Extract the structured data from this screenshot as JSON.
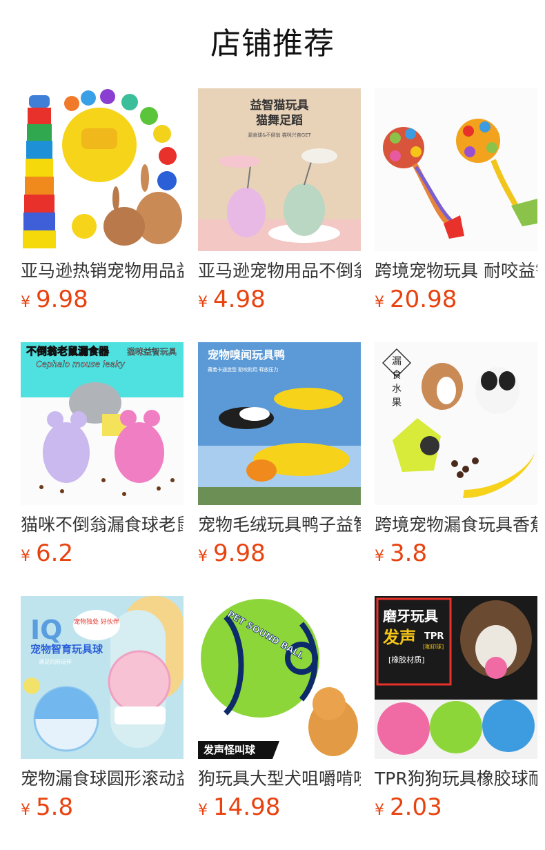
{
  "page": {
    "title": "店铺推荐"
  },
  "currency_symbol": "¥",
  "accent_color": "#e8420f",
  "products": [
    {
      "name": "亚马逊热销宠物用品益智玩具",
      "price": "9.98",
      "thumb_icon": "stacking-cups-ball-rabbit-image"
    },
    {
      "name": "亚马逊宠物用品不倒翁逗猫玩具",
      "price": "4.98",
      "thumb_icon": "cat-tumbler-toy-image",
      "thumb_text": {
        "line1": "益智猫玩具",
        "line2": "猫舞足蹈",
        "line3": "漏食球&不倒翁 猫咪兴奋GET"
      }
    },
    {
      "name": "跨境宠物玩具 耐咬益智嗅闻球",
      "price": "20.98",
      "thumb_icon": "snuffle-ball-rope-image"
    },
    {
      "name": "猫咪不倒翁漏食球老鼠玩具",
      "price": "6.2",
      "thumb_icon": "mouse-treat-tumbler-image",
      "thumb_text": {
        "line1": "不倒翁老鼠漏食器",
        "line2": "Cephalo mouse leaky",
        "badge": "猫咪益智玩具"
      }
    },
    {
      "name": "宠物毛绒玩具鸭子益智发声",
      "price": "9.98",
      "thumb_icon": "plush-duck-dog-image",
      "thumb_text": {
        "line1": "宠物嗅闻玩具鸭",
        "line2": "藏着卡通造型 耐咬耐用 释放压力"
      }
    },
    {
      "name": "跨境宠物漏食玩具香蕉造型",
      "price": "3.8",
      "thumb_icon": "banana-treat-toy-puppies-image",
      "thumb_text": {
        "v1": "漏",
        "v2": "食",
        "v3": "水",
        "v4": "果"
      }
    },
    {
      "name": "宠物漏食球圆形滚动益智玩具",
      "price": "5.8",
      "thumb_icon": "iq-treat-ball-image",
      "thumb_text": {
        "line1": "IQ",
        "bubble": "宠物独处 好伙伴",
        "line2": "宠物智育玩具球",
        "line3": "满足的陪玩伴"
      }
    },
    {
      "name": "狗玩具大型犬咀嚼啃咬发声球",
      "price": "14.98",
      "thumb_icon": "green-sound-ball-pomeranian-image",
      "thumb_text": {
        "ball": "PET SOUND BALL",
        "tag": "发声怪叫球"
      }
    },
    {
      "name": "TPR狗狗玩具橡胶球耐咬磨牙",
      "price": "2.03",
      "thumb_icon": "rubber-chew-balls-dog-image",
      "thumb_text": {
        "line1": "磨牙玩具",
        "line2": "发声",
        "line3": "TPR",
        "line4": "[咖印球]",
        "line5": "[橡胶材质]"
      }
    }
  ]
}
